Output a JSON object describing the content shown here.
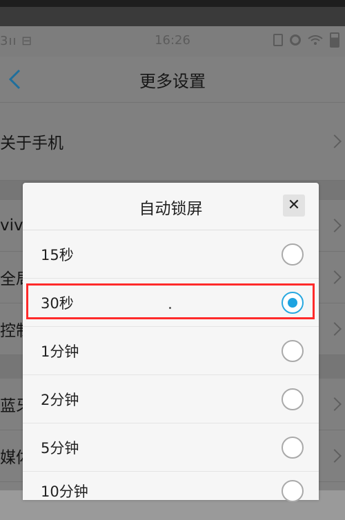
{
  "status": {
    "left_text": "3ıı ⊟",
    "time": "16:26"
  },
  "header": {
    "title": "更多设置"
  },
  "rows": [
    {
      "label": "关于手机"
    },
    {
      "label": "viv"
    },
    {
      "label": "全局"
    },
    {
      "label": "控制"
    },
    {
      "label": "蓝牙"
    },
    {
      "label": "媒体"
    }
  ],
  "dialog": {
    "title": "自动锁屏",
    "close_label": "✕",
    "options": [
      {
        "label": "15秒",
        "selected": false
      },
      {
        "label": "30秒",
        "selected": true
      },
      {
        "label": "1分钟",
        "selected": false
      },
      {
        "label": "2分钟",
        "selected": false
      },
      {
        "label": "5分钟",
        "selected": false
      },
      {
        "label": "10分钟",
        "selected": false
      }
    ]
  },
  "colors": {
    "accent": "#1ea3e0",
    "highlight_box": "#ff2a2a"
  }
}
